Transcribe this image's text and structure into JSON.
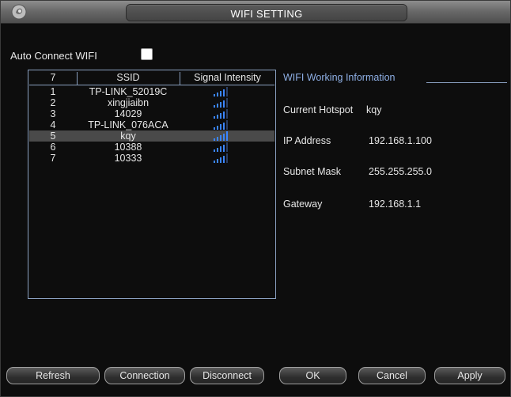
{
  "window": {
    "title": "WIFI SETTING"
  },
  "auto_connect": {
    "label": "Auto Connect WIFI",
    "checked": false
  },
  "table": {
    "headers": {
      "index": "7",
      "ssid": "SSID",
      "signal": "Signal Intensity"
    },
    "rows": [
      {
        "index": "1",
        "ssid": "TP-LINK_52019C",
        "signal_bars": 4,
        "selected": false
      },
      {
        "index": "2",
        "ssid": "xingjiaibn",
        "signal_bars": 4,
        "selected": false
      },
      {
        "index": "3",
        "ssid": "14029",
        "signal_bars": 4,
        "selected": false
      },
      {
        "index": "4",
        "ssid": "TP-LINK_076ACA",
        "signal_bars": 4,
        "selected": false
      },
      {
        "index": "5",
        "ssid": "kqy",
        "signal_bars": 5,
        "selected": true
      },
      {
        "index": "6",
        "ssid": "10388",
        "signal_bars": 4,
        "selected": false
      },
      {
        "index": "7",
        "ssid": "10333",
        "signal_bars": 4,
        "selected": false
      }
    ]
  },
  "info": {
    "heading": "WIFI Working Information",
    "current_hotspot": {
      "label": "Current Hotspot",
      "value": "kqy"
    },
    "ip": {
      "label": "IP Address",
      "value": "192.168.1.100"
    },
    "subnet": {
      "label": "Subnet Mask",
      "value": "255.255.255.0"
    },
    "gateway": {
      "label": "Gateway",
      "value": "192.168.1.1"
    }
  },
  "buttons": {
    "refresh": "Refresh",
    "connection": "Connection",
    "disconnect": "Disconnect",
    "ok": "OK",
    "cancel": "Cancel",
    "apply": "Apply"
  },
  "colors": {
    "background": "#0d0d0d",
    "signal": "#3b86ff",
    "accent_text": "#8fb0e6",
    "border": "#8aa0c0"
  },
  "icons": {
    "logo": "dvr-logo-icon",
    "signal": "signal-strength-icon"
  }
}
